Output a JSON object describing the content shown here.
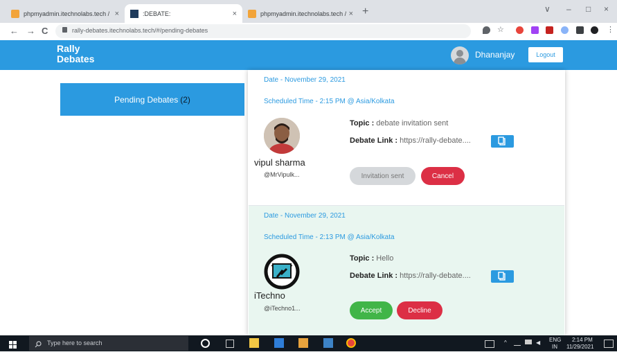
{
  "browser": {
    "tabs": [
      {
        "title": "phpmyadmin.itechnolabs.tech / ",
        "close": "×"
      },
      {
        "title": ":DEBATE:",
        "close": "×"
      },
      {
        "title": "phpmyadmin.itechnolabs.tech / l",
        "close": "×"
      }
    ],
    "new_tab": "+",
    "url": "rally-debates.itechnolabs.tech/#/pending-debates",
    "nav": {
      "back": "←",
      "forward": "→",
      "reload": "C"
    },
    "window": {
      "minimize": "–",
      "maximize": "□",
      "close": "×",
      "tab_search": "∨"
    }
  },
  "app": {
    "logo_line1": "Rally",
    "logo_line2": "Debates",
    "username": "Dhananjay",
    "logout_label": "Logout",
    "accent": "#2b9ae0"
  },
  "sidebar": {
    "pending_label": "Pending Debates",
    "pending_count": "(2)"
  },
  "debates": [
    {
      "date": "Date - November 29, 2021",
      "scheduled": "Scheduled Time - 2:15 PM @ Asia/Kolkata",
      "name": "vipul sharma",
      "handle": "@MrVipulk...",
      "topic_label": "Topic :",
      "topic": "debate invitation sent",
      "link_label": "Debate Link :",
      "link": "https://rally-debate....",
      "action_1": "Invitation sent",
      "action_2": "Cancel"
    },
    {
      "date": "Date - November 29, 2021",
      "scheduled": "Scheduled Time - 2:13 PM @ Asia/Kolkata",
      "name": "iTechno",
      "handle": "@iTechno1...",
      "topic_label": "Topic :",
      "topic": "Hello",
      "link_label": "Debate Link :",
      "link": "https://rally-debate....",
      "action_1": "Accept",
      "action_2": "Decline"
    }
  ],
  "taskbar": {
    "search_placeholder": "Type here to search",
    "lang_1": "ENG",
    "lang_2": "IN",
    "time": "2:14 PM",
    "date": "11/29/2021"
  }
}
